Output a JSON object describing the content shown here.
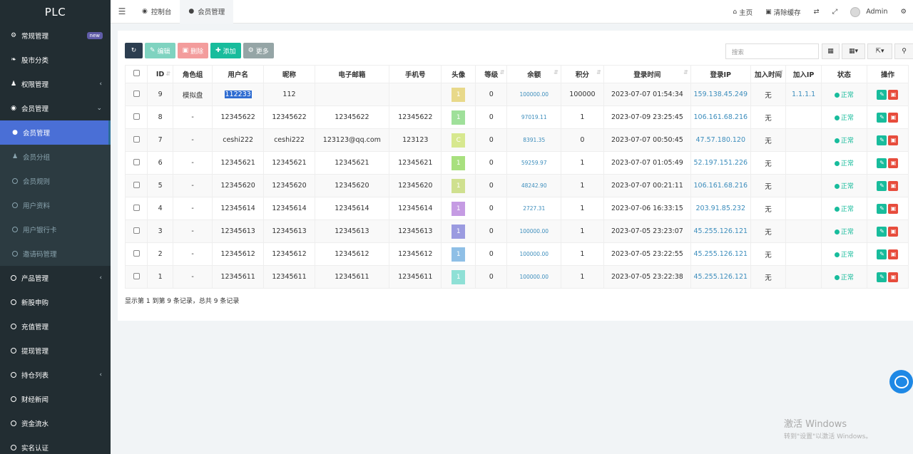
{
  "brand": "PLC",
  "sidebar": {
    "items": [
      {
        "label": "常规管理",
        "icon": "cogs-icon",
        "badge": "new"
      },
      {
        "label": "股市分类",
        "icon": "leaf-icon"
      },
      {
        "label": "权限管理",
        "icon": "users-icon",
        "chevron": true
      },
      {
        "label": "会员管理",
        "icon": "user-circle-icon",
        "chevron": true,
        "expanded": true
      }
    ],
    "submenu": [
      {
        "label": "会员管理",
        "icon": "user-icon",
        "active": true
      },
      {
        "label": "会员分组",
        "icon": "users-icon"
      },
      {
        "label": "会员规则",
        "icon": "circle-icon"
      },
      {
        "label": "用户资料",
        "icon": "circle-icon"
      },
      {
        "label": "用户银行卡",
        "icon": "circle-icon"
      },
      {
        "label": "邀请码管理",
        "icon": "circle-icon"
      }
    ],
    "items2": [
      {
        "label": "产品管理",
        "chevron": true
      },
      {
        "label": "新股申购"
      },
      {
        "label": "充值管理"
      },
      {
        "label": "提现管理"
      },
      {
        "label": "持仓列表",
        "chevron": true
      },
      {
        "label": "财经新闻"
      },
      {
        "label": "资金流水"
      },
      {
        "label": "实名认证"
      }
    ]
  },
  "topbar": {
    "tabs": [
      {
        "label": "控制台",
        "icon": "dashboard-icon"
      },
      {
        "label": "会员管理",
        "icon": "user-icon"
      }
    ],
    "home": "主页",
    "clear_cache": "清除缓存",
    "user": "Admin"
  },
  "toolbar": {
    "edit": "编辑",
    "delete": "删除",
    "add": "添加",
    "more": "更多",
    "search_placeholder": "搜索"
  },
  "table": {
    "headers": [
      "",
      "ID",
      "角色组",
      "用户名",
      "昵称",
      "电子邮箱",
      "手机号",
      "头像",
      "等级",
      "余额",
      "积分",
      "登录时间",
      "登录IP",
      "加入时间",
      "加入IP",
      "状态",
      "操作"
    ],
    "rows": [
      {
        "id": "9",
        "group": "模拟盘",
        "username": "112233",
        "nickname": "112",
        "email": "",
        "mobile": "",
        "avatar": "1",
        "avatar_color": "#e8d98a",
        "level": "0",
        "balance": "100000.00",
        "score": "100000",
        "logintime": "2023-07-07 01:54:34",
        "loginip": "159.138.45.249",
        "jointime": "无",
        "joinip": "1.1.1.1",
        "status": "正常"
      },
      {
        "id": "8",
        "group": "-",
        "username": "12345622",
        "nickname": "12345622",
        "email": "12345622",
        "mobile": "12345622",
        "avatar": "1",
        "avatar_color": "#9fe09a",
        "level": "0",
        "balance": "97019.11",
        "score": "1",
        "logintime": "2023-07-09 23:25:45",
        "loginip": "106.161.68.216",
        "jointime": "无",
        "joinip": "",
        "status": "正常"
      },
      {
        "id": "7",
        "group": "-",
        "username": "ceshi222",
        "nickname": "ceshi222",
        "email": "123123@qq.com",
        "mobile": "123123",
        "avatar": "C",
        "avatar_color": "#d7e88f",
        "level": "0",
        "balance": "8391.35",
        "score": "0",
        "logintime": "2023-07-07 00:50:45",
        "loginip": "47.57.180.120",
        "jointime": "无",
        "joinip": "",
        "status": "正常"
      },
      {
        "id": "6",
        "group": "-",
        "username": "12345621",
        "nickname": "12345621",
        "email": "12345621",
        "mobile": "12345621",
        "avatar": "1",
        "avatar_color": "#a8e07e",
        "level": "0",
        "balance": "59259.97",
        "score": "1",
        "logintime": "2023-07-07 01:05:49",
        "loginip": "52.197.151.226",
        "jointime": "无",
        "joinip": "",
        "status": "正常"
      },
      {
        "id": "5",
        "group": "-",
        "username": "12345620",
        "nickname": "12345620",
        "email": "12345620",
        "mobile": "12345620",
        "avatar": "1",
        "avatar_color": "#cfe08f",
        "level": "0",
        "balance": "48242.90",
        "score": "1",
        "logintime": "2023-07-07 00:21:11",
        "loginip": "106.161.68.216",
        "jointime": "无",
        "joinip": "",
        "status": "正常"
      },
      {
        "id": "4",
        "group": "-",
        "username": "12345614",
        "nickname": "12345614",
        "email": "12345614",
        "mobile": "12345614",
        "avatar": "1",
        "avatar_color": "#c59be3",
        "level": "0",
        "balance": "2727.31",
        "score": "1",
        "logintime": "2023-07-06 16:33:15",
        "loginip": "203.91.85.232",
        "jointime": "无",
        "joinip": "",
        "status": "正常"
      },
      {
        "id": "3",
        "group": "-",
        "username": "12345613",
        "nickname": "12345613",
        "email": "12345613",
        "mobile": "12345613",
        "avatar": "1",
        "avatar_color": "#9b9be0",
        "level": "0",
        "balance": "100000.00",
        "score": "1",
        "logintime": "2023-07-05 23:23:07",
        "loginip": "45.255.126.121",
        "jointime": "无",
        "joinip": "",
        "status": "正常"
      },
      {
        "id": "2",
        "group": "-",
        "username": "12345612",
        "nickname": "12345612",
        "email": "12345612",
        "mobile": "12345612",
        "avatar": "1",
        "avatar_color": "#8fbfe6",
        "level": "0",
        "balance": "100000.00",
        "score": "1",
        "logintime": "2023-07-05 23:22:55",
        "loginip": "45.255.126.121",
        "jointime": "无",
        "joinip": "",
        "status": "正常"
      },
      {
        "id": "1",
        "group": "-",
        "username": "12345611",
        "nickname": "12345611",
        "email": "12345611",
        "mobile": "12345611",
        "avatar": "1",
        "avatar_color": "#8fe0d6",
        "level": "0",
        "balance": "100000.00",
        "score": "1",
        "logintime": "2023-07-05 23:22:38",
        "loginip": "45.255.126.121",
        "jointime": "无",
        "joinip": "",
        "status": "正常"
      }
    ]
  },
  "pager": "显示第 1 到第 9 条记录，总共 9 条记录",
  "watermark": {
    "line1": "激活 Windows",
    "line2": "转到\"设置\"以激活 Windows。"
  },
  "colors": {
    "sidebar_bg": "#222d32",
    "active": "#4a6fd6",
    "success": "#18bc9c",
    "danger": "#e74c3c",
    "link": "#3c8dbc"
  }
}
